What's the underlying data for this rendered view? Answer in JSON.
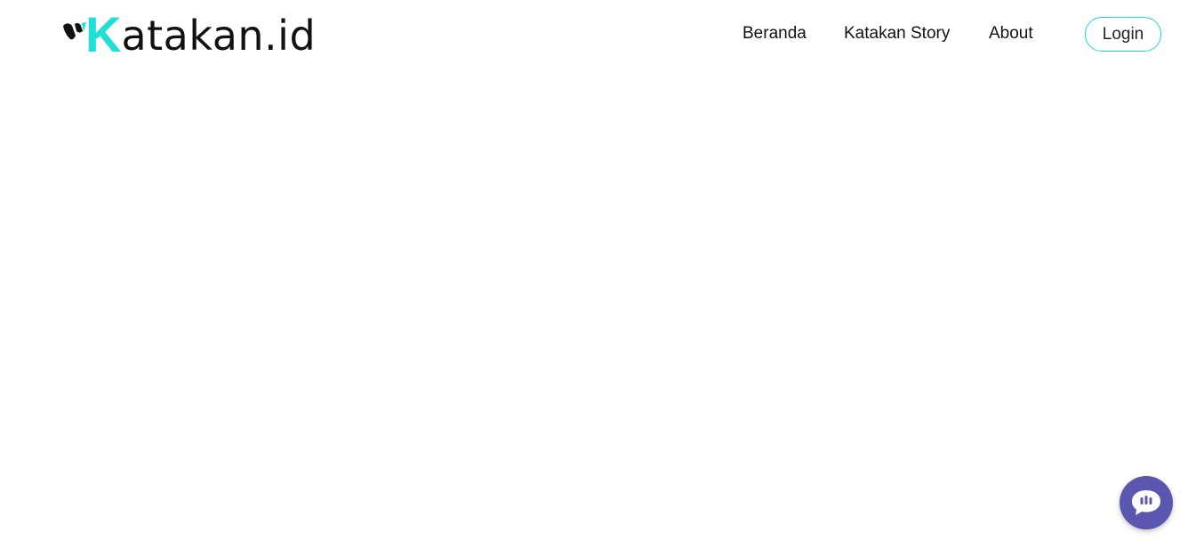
{
  "navbar": {
    "logo": {
      "letter_k": "K",
      "rest": "atakan.id",
      "accent_color": "#1fe0d6"
    },
    "links": [
      {
        "label": "Beranda"
      },
      {
        "label": "Katakan Story"
      },
      {
        "label": "About"
      }
    ],
    "login_label": "Login",
    "login_border_color": "#1fd6cf"
  },
  "chat_widget": {
    "icon": "chat-bubble-icon",
    "color": "#5b56b0"
  }
}
